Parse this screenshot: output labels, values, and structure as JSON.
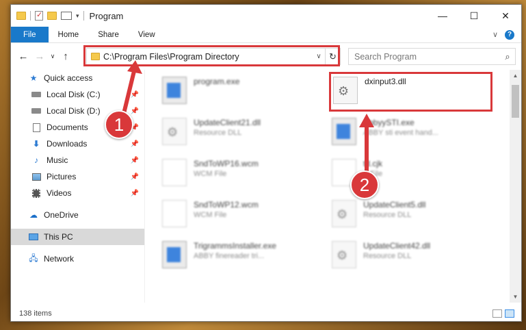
{
  "window": {
    "title": "Program",
    "controls": {
      "minimize": "—",
      "maximize": "☐",
      "close": "✕"
    }
  },
  "ribbon": {
    "tabs": [
      "File",
      "Home",
      "Share",
      "View"
    ],
    "expand_icon": "∨",
    "help_icon": "?"
  },
  "address": {
    "path": "C:\\Program Files\\Program Directory",
    "dropdown_icon": "∨",
    "refresh_icon": "↻"
  },
  "search": {
    "placeholder": "Search Program",
    "icon": "⌕"
  },
  "nav": {
    "back_icon": "←",
    "forward_icon": "→",
    "recent_icon": "∨",
    "up_icon": "↑",
    "items": [
      {
        "label": "Quick access",
        "icon": "star-icon",
        "pinned": false
      },
      {
        "label": "Local Disk (C:)",
        "icon": "disk-icon",
        "pinned": true
      },
      {
        "label": "Local Disk (D:)",
        "icon": "disk-icon",
        "pinned": true
      },
      {
        "label": "Documents",
        "icon": "document-icon",
        "pinned": true
      },
      {
        "label": "Downloads",
        "icon": "download-icon",
        "pinned": true
      },
      {
        "label": "Music",
        "icon": "music-icon",
        "pinned": true
      },
      {
        "label": "Pictures",
        "icon": "pictures-icon",
        "pinned": true
      },
      {
        "label": "Videos",
        "icon": "videos-icon",
        "pinned": true
      },
      {
        "label": "OneDrive",
        "icon": "cloud-icon",
        "pinned": false
      },
      {
        "label": "This PC",
        "icon": "pc-icon",
        "pinned": false,
        "selected": true
      },
      {
        "label": "Network",
        "icon": "network-icon",
        "pinned": false
      }
    ]
  },
  "files": [
    {
      "name": "program.exe",
      "type": "",
      "icon": "exe-icon"
    },
    {
      "name": "dxinput3.dll",
      "type": "",
      "icon": "dll-icon"
    },
    {
      "name": "UpdateClient21.dll",
      "type": "Resource DLL",
      "icon": "dll-icon"
    },
    {
      "name": "AbbyySTI.exe",
      "type": "ABBY sti event hand...",
      "icon": "exe-icon"
    },
    {
      "name": "SndToWP16.wcm",
      "type": "WCM File",
      "icon": "file-icon"
    },
    {
      "name": "td.cjk",
      "type": "K File",
      "icon": "file-icon"
    },
    {
      "name": "SndToWP12.wcm",
      "type": "WCM File",
      "icon": "file-icon"
    },
    {
      "name": "UpdateClient5.dll",
      "type": "Resource DLL",
      "icon": "dll-icon"
    },
    {
      "name": "TrigrammsInstaller.exe",
      "type": "ABBY finereader tri...",
      "icon": "exe-icon"
    },
    {
      "name": "UpdateClient42.dll",
      "type": "Resource DLL",
      "icon": "dll-icon"
    }
  ],
  "status": {
    "item_count": "138 items"
  },
  "callouts": {
    "first": "1",
    "second": "2"
  },
  "colors": {
    "highlight": "#d9383a",
    "accent": "#1979ca"
  }
}
